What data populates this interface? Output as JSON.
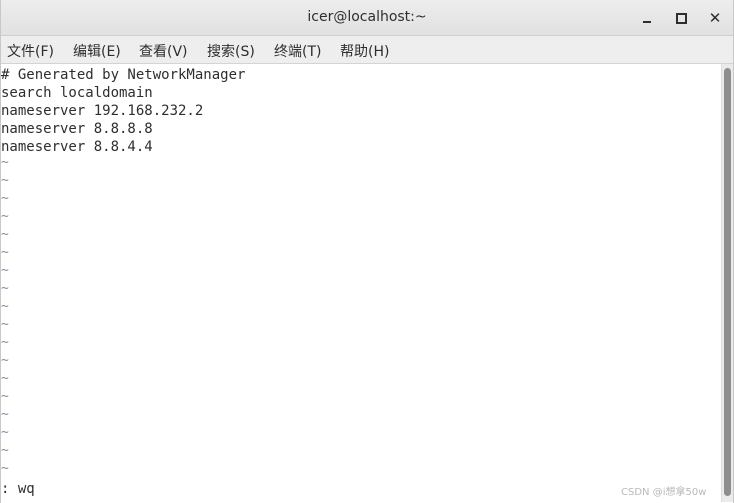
{
  "window": {
    "title": "icer@localhost:~"
  },
  "controls": {
    "minimize_icon": "minimize-icon",
    "maximize_icon": "maximize-icon",
    "close_icon": "close-icon"
  },
  "menu": {
    "items": [
      {
        "label": "文件(F)"
      },
      {
        "label": "编辑(E)"
      },
      {
        "label": "查看(V)"
      },
      {
        "label": "搜索(S)"
      },
      {
        "label": "终端(T)"
      },
      {
        "label": "帮助(H)"
      }
    ]
  },
  "terminal": {
    "lines": [
      "# Generated by NetworkManager",
      "search localdomain",
      "nameserver 192.168.232.2",
      "nameserver 8.8.8.8",
      "nameserver 8.8.4.4"
    ],
    "empty_line_marker": "~",
    "empty_line_count": 18,
    "command_line": ": wq"
  },
  "watermark": "CSDN @i想拿50w"
}
